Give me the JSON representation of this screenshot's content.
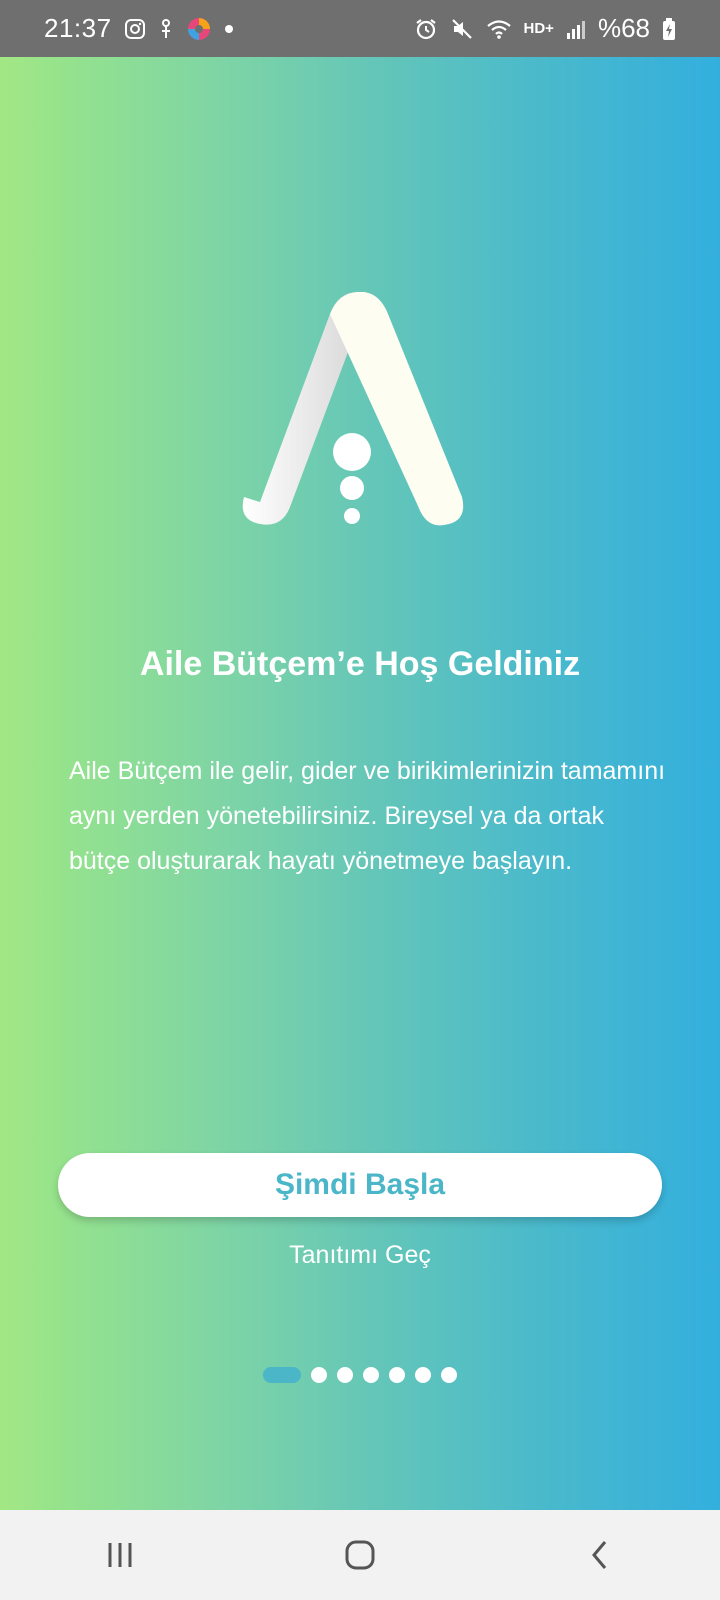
{
  "status_bar": {
    "time": "21:37",
    "icons_left": [
      "instagram-icon",
      "app-notification-icon",
      "browser-icon",
      "dot-icon"
    ],
    "icons_right": [
      "alarm-icon",
      "mute-icon",
      "wifi-icon",
      "network-hd-icon",
      "signal-icon",
      "battery-icon"
    ],
    "network_label": "HD+",
    "battery_text": "%68"
  },
  "onboarding": {
    "title": "Aile Bütçem’e Hoş Geldiniz",
    "description": "Aile Bütçem ile gelir, gider ve birikimlerinizin tamamını aynı yerden yönetebilirsiniz. Bireysel ya da ortak bütçe oluşturarak hayatı yönetmeye başlayın.",
    "primary_button": "Şimdi Başla",
    "skip_link": "Tanıtımı Geç",
    "page_count": 7,
    "active_page": 1
  },
  "colors": {
    "gradient_left": "#a3e784",
    "gradient_right": "#33afde",
    "accent": "#4ab6c7"
  },
  "nav_bar": {
    "buttons": [
      "recent-apps-icon",
      "home-icon",
      "back-icon"
    ]
  }
}
